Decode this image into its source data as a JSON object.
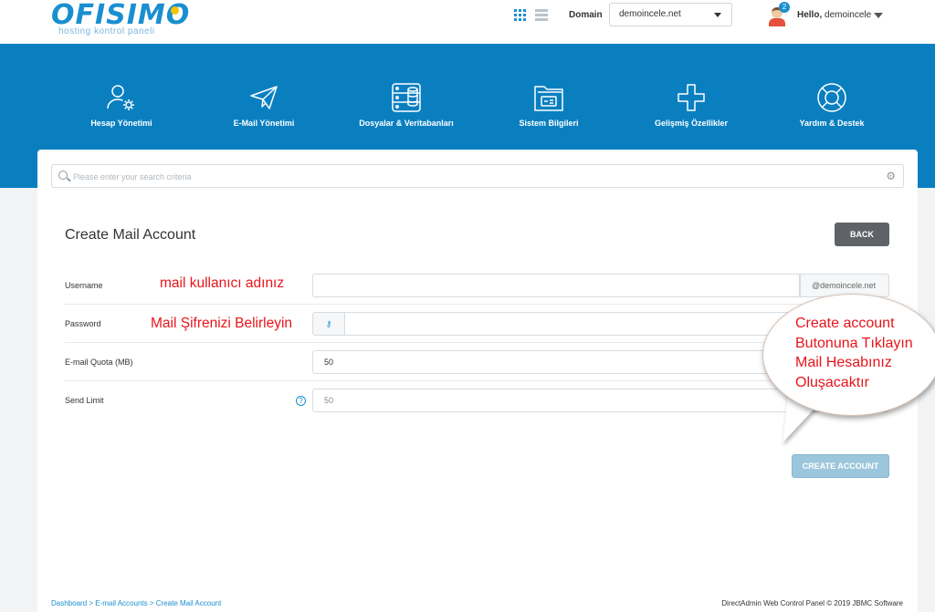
{
  "header": {
    "logo_text": "OFISIMO",
    "logo_tagline": "hosting kontrol paneli",
    "domain_label": "Domain",
    "domain_value": "demoincele.net",
    "notification_count": "2",
    "hello_prefix": "Hello,",
    "username": "demoincele"
  },
  "nav": {
    "items": [
      {
        "label": "Hesap Yönetimi",
        "icon": "user-gear-icon"
      },
      {
        "label": "E-Mail Yönetimi",
        "icon": "paper-plane-icon"
      },
      {
        "label": "Dosyalar & Veritabanları",
        "icon": "server-database-icon"
      },
      {
        "label": "Sistem Bilgileri",
        "icon": "folder-info-icon"
      },
      {
        "label": "Gelişmiş Özellikler",
        "icon": "plus-icon"
      },
      {
        "label": "Yardım & Destek",
        "icon": "lifebuoy-icon"
      }
    ]
  },
  "search": {
    "placeholder": "Please enter your search criteria"
  },
  "form": {
    "title": "Create Mail Account",
    "back_label": "BACK",
    "username_label": "Username",
    "username_value": "",
    "username_suffix": "@demoincele.net",
    "password_label": "Password",
    "password_value": "",
    "quota_label": "E-mail Quota (MB)",
    "quota_value": "50",
    "send_limit_label": "Send Limit",
    "send_limit_value": "50",
    "help_glyph": "?",
    "create_label": "CREATE ACCOUNT"
  },
  "annotations": {
    "username_hint": "mail kullanıcı adınız",
    "password_hint": "Mail Şifrenizi Belirleyin",
    "bubble": "Create account Butonuna Tıklayın Mail Hesabınız Oluşacaktır"
  },
  "footer": {
    "breadcrumb": "Dashboard > E-mail Accounts > Create Mail Account",
    "copyright": "DirectAdmin Web Control Panel © 2019 JBMC Software"
  },
  "colors": {
    "brand_blue": "#0a7fc0",
    "annotation_red": "#e8141a",
    "back_button": "#5f6368",
    "create_button": "#9cc6dc"
  }
}
